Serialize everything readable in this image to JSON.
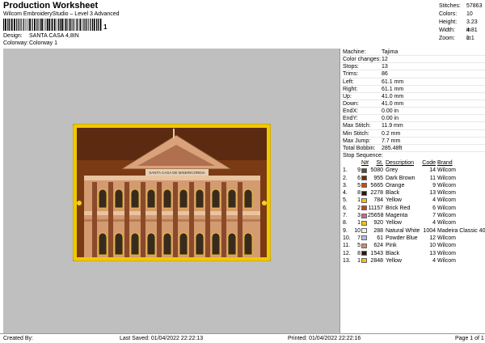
{
  "header": {
    "title": "Production Worksheet",
    "subtitle": "Wilcom EmbroideryStudio – Level 3 Advanced",
    "barcode_mark": "1",
    "design_label": "Design:",
    "design_value": "SANTA CASA 4,8IN",
    "colorway_label": "Colorway:",
    "colorway_value": "Colorway 1"
  },
  "top_stats": [
    {
      "label": "Stitches:",
      "value": "57863"
    },
    {
      "label": "Colors:",
      "value": "10"
    },
    {
      "label": "Height:",
      "value": "3.23 in"
    },
    {
      "label": "Width:",
      "value": "4.81 in"
    },
    {
      "label": "Zoom:",
      "value": "1:1"
    }
  ],
  "machine_info": [
    {
      "label": "Machine:",
      "value": "Tajima"
    },
    {
      "label": "Color changes:",
      "value": "12"
    },
    {
      "label": "Stops:",
      "value": "13"
    },
    {
      "label": "Trims:",
      "value": "86"
    },
    {
      "label": "Left:",
      "value": "61.1 mm"
    },
    {
      "label": "Right:",
      "value": "61.1 mm"
    },
    {
      "label": "Up:",
      "value": "41.0 mm"
    },
    {
      "label": "Down:",
      "value": "41.0 mm"
    },
    {
      "label": "EndX:",
      "value": "0.00 in"
    },
    {
      "label": "EndY:",
      "value": "0.00 in"
    },
    {
      "label": "Max Stitch:",
      "value": "11.9 mm"
    },
    {
      "label": "Min Stitch:",
      "value": "0.2 mm"
    },
    {
      "label": "Max Jump:",
      "value": "7.7 mm"
    },
    {
      "label": "Total Bobbin:",
      "value": "285.48ft"
    }
  ],
  "stop_sequence": {
    "title": "Stop Sequence:",
    "headers": {
      "n": "N#",
      "st": "St.",
      "desc": "Description",
      "code": "Code",
      "brand": "Brand"
    },
    "rows": [
      {
        "stop": "1.",
        "n": "9",
        "color": "#5c4a36",
        "st": "5080",
        "desc": "Grey",
        "code": "14",
        "brand": "Wilcom"
      },
      {
        "stop": "2.",
        "n": "6",
        "color": "#6e2e10",
        "st": "955",
        "desc": "Dark Brown",
        "code": "11",
        "brand": "Wilcom"
      },
      {
        "stop": "3.",
        "n": "5",
        "color": "#c4500e",
        "st": "5665",
        "desc": "Orange",
        "code": "9",
        "brand": "Wilcom"
      },
      {
        "stop": "4.",
        "n": "8",
        "color": "#2a1810",
        "st": "2278",
        "desc": "Black",
        "code": "13",
        "brand": "Wilcom"
      },
      {
        "stop": "5.",
        "n": "1",
        "color": "#f3c20a",
        "st": "784",
        "desc": "Yellow",
        "code": "4",
        "brand": "Wilcom"
      },
      {
        "stop": "6.",
        "n": "2",
        "color": "#b8472c",
        "st": "11157",
        "desc": "Brick Red",
        "code": "6",
        "brand": "Wilcom"
      },
      {
        "stop": "7.",
        "n": "3",
        "color": "#c46a8c",
        "st": "25658",
        "desc": "Magenta",
        "code": "7",
        "brand": "Wilcom"
      },
      {
        "stop": "8.",
        "n": "1",
        "color": "#f3c20a",
        "st": "920",
        "desc": "Yellow",
        "code": "4",
        "brand": "Wilcom"
      },
      {
        "stop": "9.",
        "n": "10",
        "color": "#f2efe6",
        "st": "288",
        "desc": "Natural White",
        "code": "1004",
        "brand": "Madeira Classic 40"
      },
      {
        "stop": "10.",
        "n": "7",
        "color": "#b9bddc",
        "st": "61",
        "desc": "Powder Blue",
        "code": "12",
        "brand": "Wilcom"
      },
      {
        "stop": "11.",
        "n": "5",
        "color": "#d88a70",
        "st": "624",
        "desc": "Pink",
        "code": "10",
        "brand": "Wilcom"
      },
      {
        "stop": "12.",
        "n": "8",
        "color": "#2a1810",
        "st": "1543",
        "desc": "Black",
        "code": "13",
        "brand": "Wilcom"
      },
      {
        "stop": "13.",
        "n": "1",
        "color": "#f3c20a",
        "st": "2848",
        "desc": "Yellow",
        "code": "4",
        "brand": "Wilcom"
      }
    ]
  },
  "design_preview": {
    "banner_text": "SANTA CASA DE MISERICORDIA",
    "colors": {
      "frame": "#f0c800",
      "sky": "#7a3a14",
      "facade": "#d49a70",
      "shadow": "#8a4a2a",
      "window": "#3a2a1e",
      "glow": "#f0d020"
    }
  },
  "footer": {
    "created": "Created By:",
    "saved": "Last Saved: 01/04/2022 22:22:13",
    "printed": "Printed: 01/04/2022 22:22:16",
    "page": "Page 1 of 1"
  }
}
